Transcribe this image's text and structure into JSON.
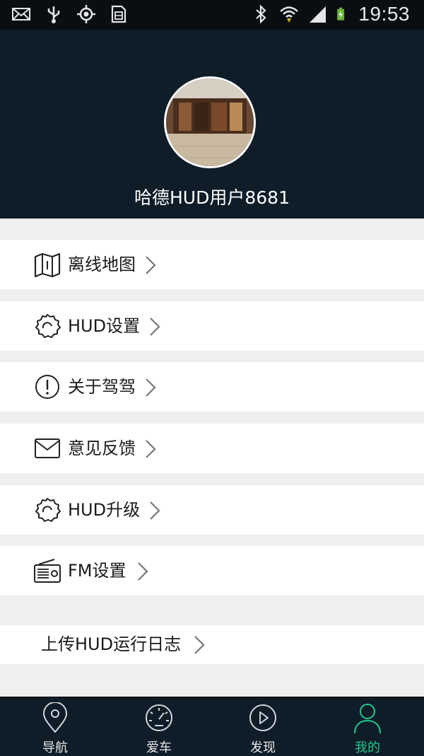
{
  "status_bar": {
    "time": "19:53",
    "icons": [
      "mail-icon",
      "usb-icon",
      "gps-icon",
      "sim-icon",
      "bluetooth-icon",
      "wifi-icon",
      "signal-icon",
      "battery-charging-icon"
    ]
  },
  "profile": {
    "username": "哈德HUD用户8681"
  },
  "menu": {
    "items": [
      {
        "label": "离线地图",
        "icon": "map-icon"
      },
      {
        "label": "HUD设置",
        "icon": "gear-icon"
      },
      {
        "label": "关于驾驾",
        "icon": "info-icon"
      },
      {
        "label": "意见反馈",
        "icon": "mail-icon"
      },
      {
        "label": "HUD升级",
        "icon": "gear-icon"
      },
      {
        "label": "FM设置",
        "icon": "radio-icon"
      }
    ],
    "upload_log": "上传HUD运行日志"
  },
  "bottom_nav": {
    "tabs": [
      {
        "label": "导航",
        "icon": "location-pin-icon"
      },
      {
        "label": "爱车",
        "icon": "speedometer-icon"
      },
      {
        "label": "发现",
        "icon": "play-circle-icon"
      },
      {
        "label": "我的",
        "icon": "user-icon",
        "active": true
      }
    ],
    "active_color": "#1fc98a"
  }
}
